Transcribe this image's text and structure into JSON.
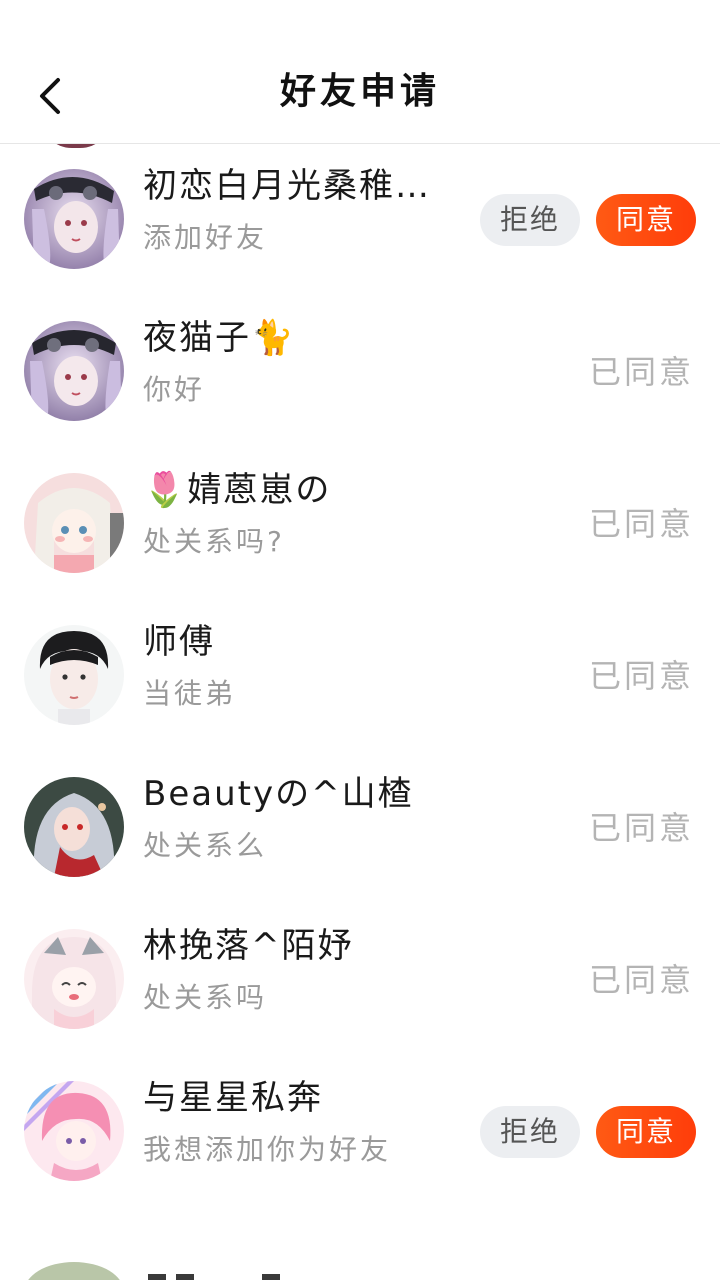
{
  "header": {
    "title": "好友申请",
    "back_icon": "chevron-left-icon"
  },
  "requests": [
    {
      "name": "初恋白月光桑稚…",
      "message": "添加好友",
      "state": "pending",
      "reject_label": "拒绝",
      "agree_label": "同意"
    },
    {
      "name": "夜猫子🐈",
      "message": "你好",
      "state": "agreed",
      "status_label": "已同意"
    },
    {
      "name": "🌷婧蒽崽の",
      "message": "处关系吗?",
      "state": "agreed",
      "status_label": "已同意"
    },
    {
      "name": "师傅",
      "message": "当徒弟",
      "state": "agreed",
      "status_label": "已同意"
    },
    {
      "name": "Beautyの^山楂",
      "message": "处关系么",
      "state": "agreed",
      "status_label": "已同意"
    },
    {
      "name": "林挽落^陌妤",
      "message": "处关系吗",
      "state": "agreed",
      "status_label": "已同意"
    },
    {
      "name": "与星星私奔",
      "message": "我想添加你为好友",
      "state": "pending",
      "reject_label": "拒绝",
      "agree_label": "同意"
    }
  ],
  "colors": {
    "agree_button": "#ff4a10",
    "reject_button_bg": "#eceef1",
    "status_text": "#b4b4b4",
    "message_text": "#9a9a9a"
  }
}
